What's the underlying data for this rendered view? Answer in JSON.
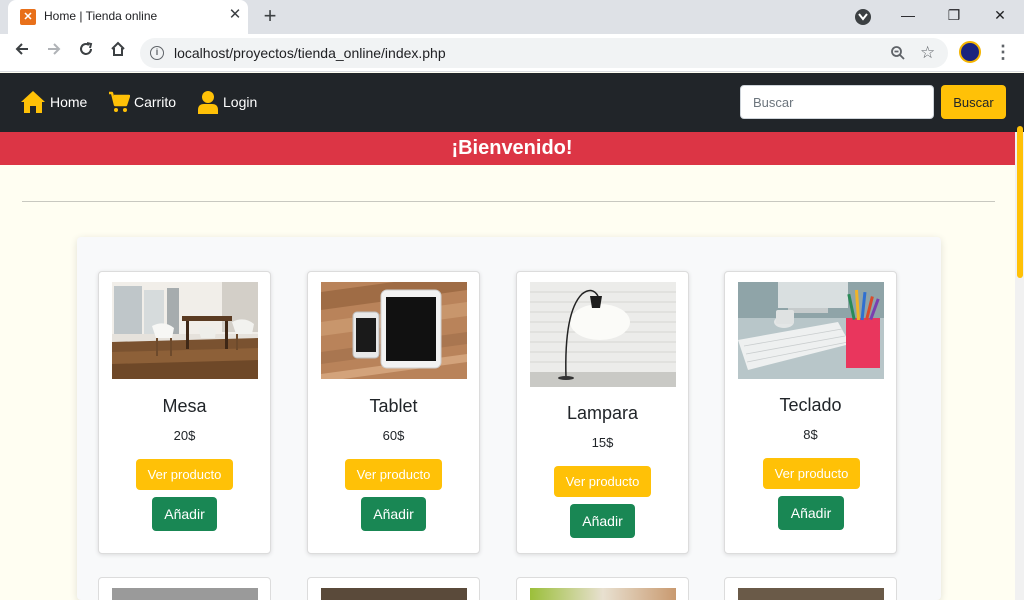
{
  "browser": {
    "tab_title": "Home | Tienda online",
    "url": "localhost/proyectos/tienda_online/index.php"
  },
  "nav": {
    "home": "Home",
    "cart": "Carrito",
    "login": "Login",
    "search_placeholder": "Buscar",
    "search_button": "Buscar"
  },
  "banner": "¡Bienvenido!",
  "products": [
    {
      "name": "Mesa",
      "price": "20$",
      "view_label": "Ver producto",
      "add_label": "Añadir"
    },
    {
      "name": "Tablet",
      "price": "60$",
      "view_label": "Ver producto",
      "add_label": "Añadir"
    },
    {
      "name": "Lampara",
      "price": "15$",
      "view_label": "Ver producto",
      "add_label": "Añadir"
    },
    {
      "name": "Teclado",
      "price": "8$",
      "view_label": "Ver producto",
      "add_label": "Añadir"
    }
  ],
  "icons": {
    "home": "home-icon",
    "cart": "cart-icon",
    "login": "user-icon"
  },
  "colors": {
    "navbar": "#212529",
    "accent": "#ffc107",
    "banner": "#dc3545",
    "add_button": "#198754"
  }
}
